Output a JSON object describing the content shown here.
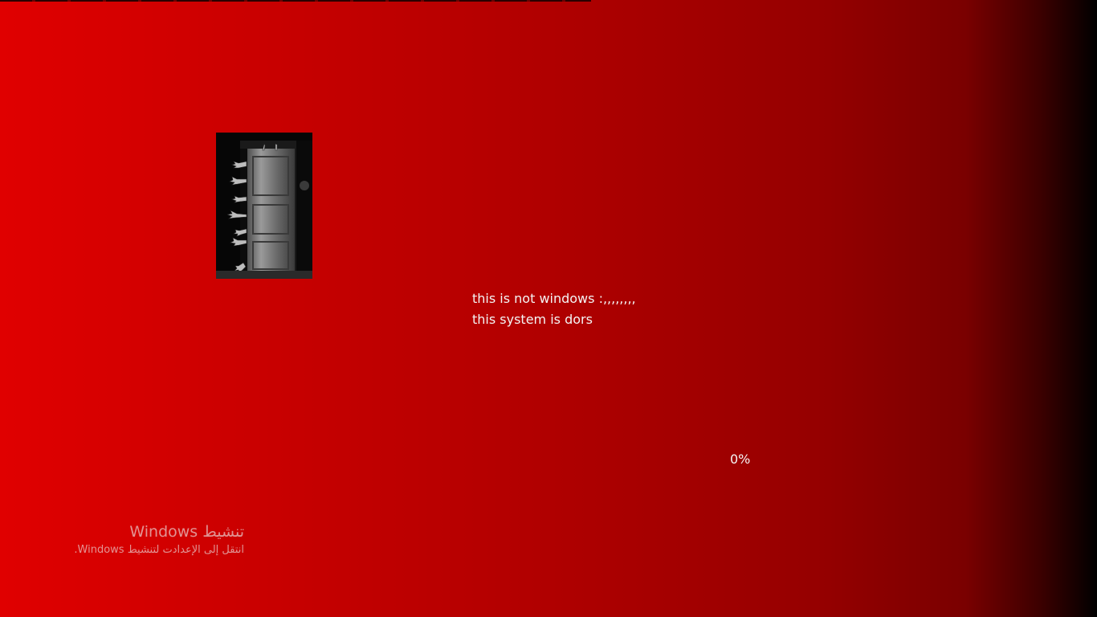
{
  "desktop": {
    "background_gradient": [
      "#e00000",
      "#b00000",
      "#7a0000",
      "#000000"
    ]
  },
  "image": {
    "icon": "creepy-door-hands-photo"
  },
  "message": {
    "line1": "this is not windows :,,,,,,,,",
    "line2": "this system is dors"
  },
  "progress": {
    "value": 0,
    "label": "0%"
  },
  "activation_watermark": {
    "title": "تنشيط Windows",
    "subtitle": "انتقل إلى الإعدادت لتنشيط Windows."
  }
}
